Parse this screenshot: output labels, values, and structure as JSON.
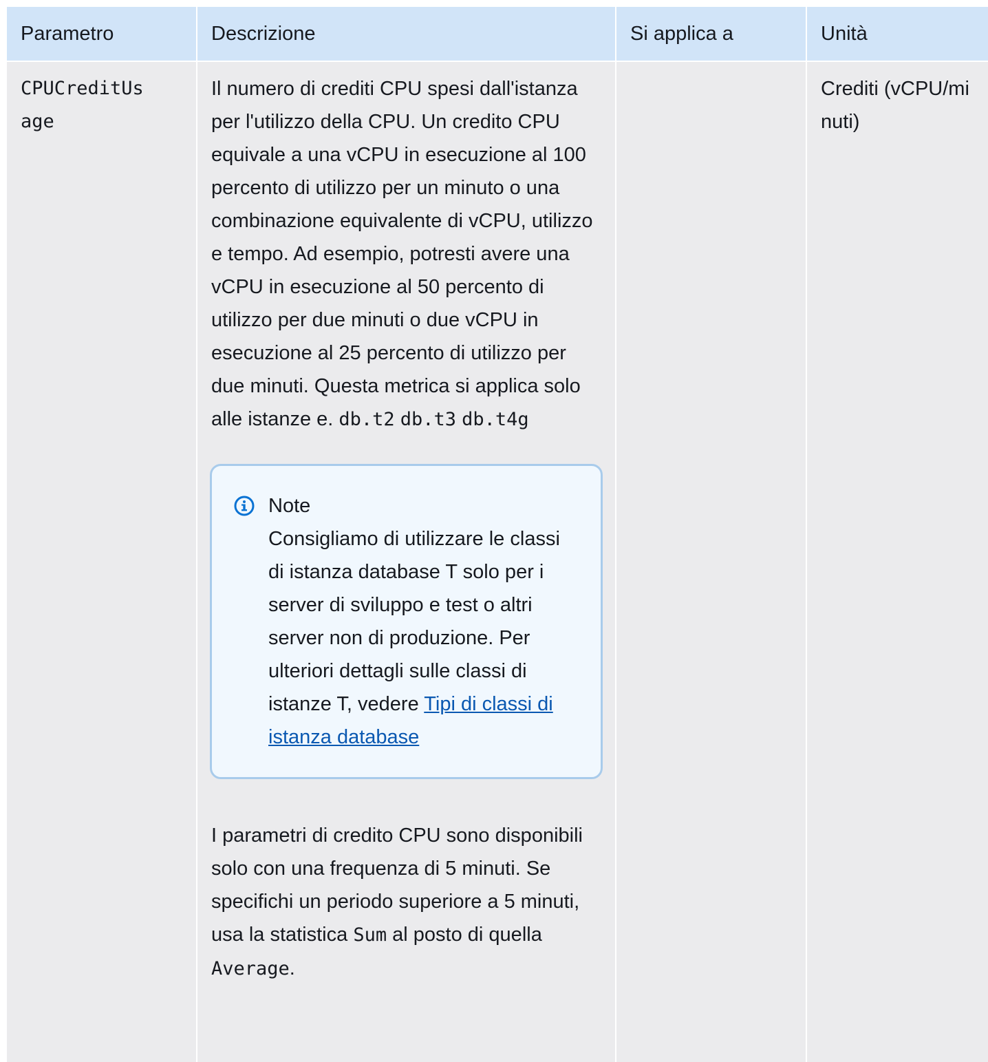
{
  "table": {
    "headers": {
      "parameter": "Parametro",
      "description": "Descrizione",
      "applies_to": "Si applica a",
      "unit": "Unità"
    },
    "row": {
      "parameter": "CPUCreditUsage",
      "description_main": "Il numero di crediti CPU spesi dall'istanza per l'utilizzo della CPU. Un credito CPU equivale a una vCPU in esecuzione al 100 percento di utilizzo per un minuto o una combinazione equivalente di vCPU, utilizzo e tempo. Ad esempio, potresti avere una vCPU in esecuzione al 50 percento di utilizzo per due minuti o due vCPU in esecuzione al 25 percento di utilizzo per due minuti. Questa metrica si applica solo alle istanze e.",
      "code_t2": "db.t2",
      "code_t3": "db.t3",
      "code_t4g": "db.t4g",
      "note": {
        "icon": "info-icon",
        "title": "Note",
        "body": "Consigliamo di utilizzare le classi di istanza database T solo per i server di sviluppo e test o altri server non di produzione. Per ulteriori dettagli sulle classi di istanze T, vedere",
        "link_text": "Tipi di classi di istanza database"
      },
      "credit_text_1": "I parametri di credito CPU sono disponibili solo con una frequenza di 5 minuti. Se specifichi un periodo superiore a 5 minuti, usa la statistica",
      "code_sum": "Sum",
      "credit_text_2": "al posto di quella",
      "code_average": "Average",
      "credit_text_3": ".",
      "applies_to": "",
      "unit": "Crediti (vCPU/minuti)"
    }
  },
  "colors": {
    "header_bg": "#d1e4f8",
    "cell_bg": "#ebebed",
    "note_bg": "#f1f8fe",
    "note_border": "#a8cbeb",
    "link": "#0a58b1",
    "info_icon": "#0972d3"
  }
}
